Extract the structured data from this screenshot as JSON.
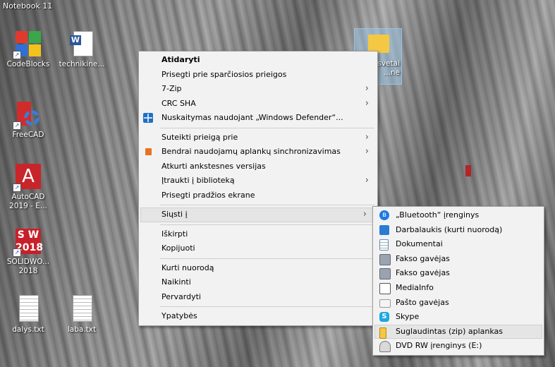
{
  "desktop": {
    "title": "Notebook 11",
    "icons": [
      {
        "label": "CodeBlocks"
      },
      {
        "label": "technikine..."
      },
      {
        "label": "FreeCAD"
      },
      {
        "label": "AutoCAD 2019 - E..."
      },
      {
        "label": "SOLIDWO... 2018"
      },
      {
        "label": "dalys.txt"
      },
      {
        "label": "laba.txt"
      },
      {
        "label": "...svetai ...ne"
      }
    ]
  },
  "context_menu": {
    "items": [
      {
        "label": "Atidaryti"
      },
      {
        "label": "Prisegti prie sparčiosios prieigos"
      },
      {
        "label": "7-Zip"
      },
      {
        "label": "CRC SHA"
      },
      {
        "label": "Nuskaitymas naudojant „Windows Defender“..."
      },
      {
        "label": "Suteikti prieigą prie"
      },
      {
        "label": "Bendrai naudojamų aplankų sinchronizavimas"
      },
      {
        "label": "Atkurti ankstesnes versijas"
      },
      {
        "label": "Įtraukti į biblioteką"
      },
      {
        "label": "Prisegti pradžios ekrane"
      },
      {
        "label": "Siųsti į"
      },
      {
        "label": "Iškirpti"
      },
      {
        "label": "Kopijuoti"
      },
      {
        "label": "Kurti nuorodą"
      },
      {
        "label": "Naikinti"
      },
      {
        "label": "Pervardyti"
      },
      {
        "label": "Ypatybės"
      }
    ],
    "arrow": "›"
  },
  "send_to_menu": {
    "items": [
      {
        "label": "„Bluetooth“ įrenginys"
      },
      {
        "label": "Darbalaukis (kurti nuorodą)"
      },
      {
        "label": "Dokumentai"
      },
      {
        "label": "Fakso gavėjas"
      },
      {
        "label": "Fakso gavėjas"
      },
      {
        "label": "MediaInfo"
      },
      {
        "label": "Pašto gavėjas"
      },
      {
        "label": "Skype"
      },
      {
        "label": "Suglaudintas (zip) aplankas"
      },
      {
        "label": "DVD RW įrenginys (E:)"
      }
    ]
  },
  "colors": {
    "menu_bg": "#f2f2f2",
    "hover_bg": "#e5e5e5",
    "bluetooth": "#1e7ae0",
    "skype": "#1ea7e1"
  }
}
